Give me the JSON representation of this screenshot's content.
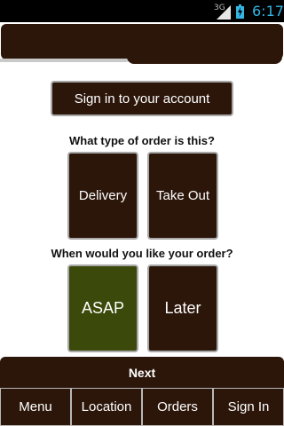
{
  "status_bar": {
    "network_type": "3G",
    "time": "6:17",
    "icons": [
      "signal-icon",
      "battery-charging-icon"
    ]
  },
  "content": {
    "signin_label": "Sign in to your account",
    "order_type_question": "What type of order is this?",
    "order_types": [
      "Delivery",
      "Take Out"
    ],
    "timing_question": "When would you like your order?",
    "timing_options": [
      "ASAP",
      "Later"
    ],
    "selected_timing": "ASAP"
  },
  "next_label": "Next",
  "nav": {
    "items": [
      "Menu",
      "Location",
      "Orders",
      "Sign In"
    ]
  },
  "colors": {
    "primary_brown": "#2c160a",
    "selected_green": "#3b4a0a",
    "clock_blue": "#33b5e5"
  }
}
